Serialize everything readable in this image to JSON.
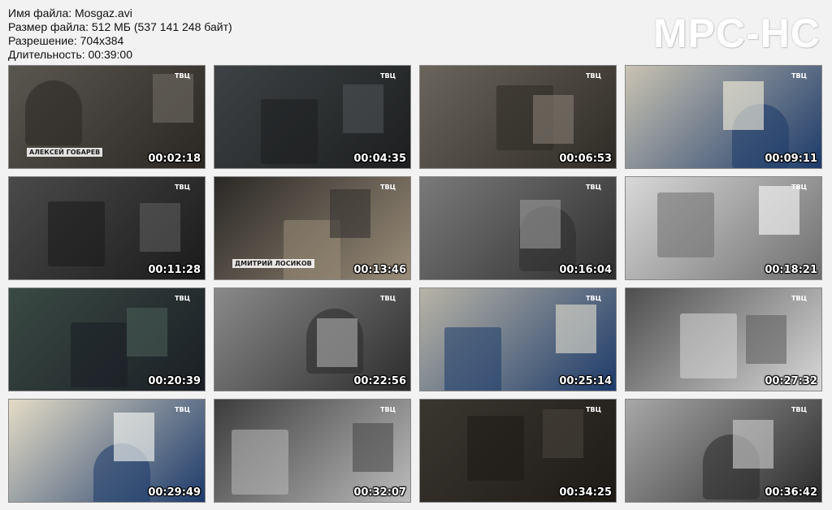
{
  "file_info": {
    "name": "Имя файла: Mosgaz.avi",
    "size": "Размер файла: 512 МБ (537 141 248 байт)",
    "resolution": "Разрешение: 704x384",
    "duration": "Длительность: 00:39:00"
  },
  "watermark": "MPC-HC",
  "channel_logo": "ТВЦ",
  "thumbnails": [
    {
      "time": "00:02:18",
      "caption": "АЛЕКСЕЙ ГОБАРЕВ",
      "bg": "#5a5650",
      "accent": "#2a2622"
    },
    {
      "time": "00:04:35",
      "caption": "",
      "bg": "#3e4244",
      "accent": "#1c1e1f"
    },
    {
      "time": "00:06:53",
      "caption": "",
      "bg": "#6a655c",
      "accent": "#2e2a25"
    },
    {
      "time": "00:09:11",
      "caption": "",
      "bg": "#c9c3b2",
      "accent": "#1c3a6a"
    },
    {
      "time": "00:11:28",
      "caption": "",
      "bg": "#4a4a4a",
      "accent": "#1a1a1a"
    },
    {
      "time": "00:13:46",
      "caption": "ДМИТРИЙ ЛОСИКОВ",
      "bg": "#2a2826",
      "accent": "#9a8c78"
    },
    {
      "time": "00:16:04",
      "caption": "",
      "bg": "#7a7a7a",
      "accent": "#2e2e2e"
    },
    {
      "time": "00:18:21",
      "caption": "",
      "bg": "#d8d8d8",
      "accent": "#6e6e6e"
    },
    {
      "time": "00:20:39",
      "caption": "",
      "bg": "#3a4a44",
      "accent": "#1a1e24"
    },
    {
      "time": "00:22:56",
      "caption": "",
      "bg": "#8a8a8a",
      "accent": "#2c2c2c"
    },
    {
      "time": "00:25:14",
      "caption": "",
      "bg": "#b8b4a6",
      "accent": "#1c3a6a"
    },
    {
      "time": "00:27:32",
      "caption": "",
      "bg": "#4e4e4e",
      "accent": "#d8d8d8"
    },
    {
      "time": "00:29:49",
      "caption": "",
      "bg": "#e4dcc6",
      "accent": "#1c3a6a"
    },
    {
      "time": "00:32:07",
      "caption": "",
      "bg": "#3c3c3c",
      "accent": "#bcbcbc"
    },
    {
      "time": "00:34:25",
      "caption": "",
      "bg": "#3a3630",
      "accent": "#1e1a16"
    },
    {
      "time": "00:36:42",
      "caption": "",
      "bg": "#a8a8a8",
      "accent": "#2a2a2a"
    }
  ]
}
